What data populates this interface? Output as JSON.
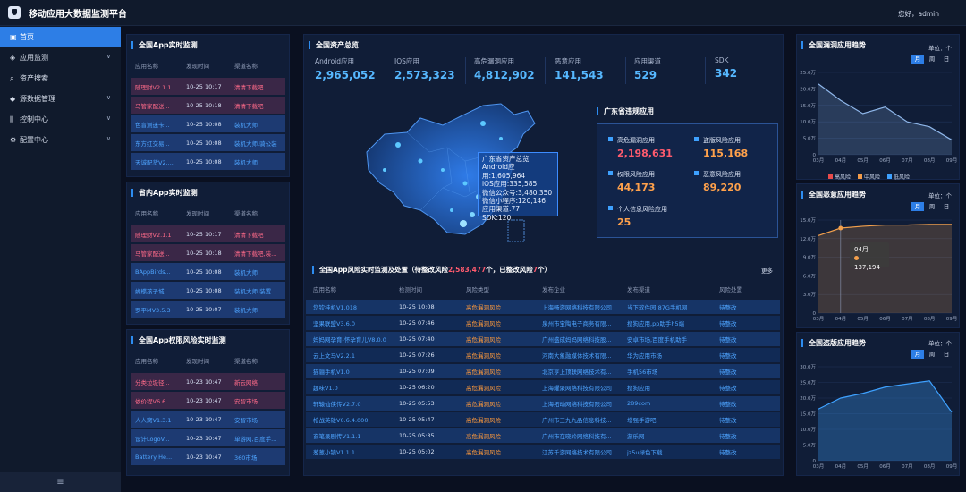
{
  "header": {
    "title": "移动应用大数据监测平台",
    "user": "您好，admin"
  },
  "sidebar": {
    "items": [
      {
        "label": "首页",
        "icon": "home-icon",
        "expandable": false
      },
      {
        "label": "应用监测",
        "icon": "cube-icon",
        "expandable": true
      },
      {
        "label": "资产搜索",
        "icon": "search-icon",
        "expandable": false
      },
      {
        "label": "源数据管理",
        "icon": "database-icon",
        "expandable": true
      },
      {
        "label": "控制中心",
        "icon": "sliders-icon",
        "expandable": true
      },
      {
        "label": "配置中心",
        "icon": "gear-icon",
        "expandable": true
      }
    ],
    "collapse_icon": "menu-collapse-icon"
  },
  "national_realtime": {
    "title": "全国App实时监测",
    "headers": [
      "应用名称",
      "发现时间",
      "渠道名称"
    ],
    "rows": [
      [
        "随理财V2.1.1",
        "10-25 10:17",
        "清清下载吧"
      ],
      [
        "马管家配送...",
        "10-25 10:18",
        "清清下载吧"
      ],
      [
        "色盲测迷卡...",
        "10-25 10:08",
        "装机大师"
      ],
      [
        "东方红交易...",
        "10-25 10:08",
        "装机大师,骑公装"
      ],
      [
        "天诚配货V2....",
        "10-25 10:08",
        "装机大师"
      ]
    ]
  },
  "provincial_realtime": {
    "title": "省内App实时监测",
    "headers": [
      "应用名称",
      "发现时间",
      "渠道名称"
    ],
    "rows": [
      [
        "随理财V2.1.1",
        "10-25 10:17",
        "清清下载吧"
      ],
      [
        "马管家配送...",
        "10-25 10:18",
        "清清下载吧,装..."
      ],
      [
        "BAppBirds...",
        "10-25 10:08",
        "装机大师"
      ],
      [
        "蝴蝶孩子城...",
        "10-25 10:08",
        "装机大师,装置..."
      ],
      [
        "罗平MV3.5.3",
        "10-25 10:07",
        "装机大师"
      ]
    ]
  },
  "permission_risk": {
    "title": "全国App权限风险实时监测",
    "headers": [
      "应用名称",
      "发现时间",
      "渠道名称"
    ],
    "rows": [
      [
        "分类垃圾径...",
        "10-23 10:47",
        "新云网络"
      ],
      [
        "依价程V6.6....",
        "10-23 10:47",
        "安智市场"
      ],
      [
        "人人窝V1.3.1",
        "10-23 10:47",
        "安智市场"
      ],
      [
        "设计LogoV...",
        "10-23 10:47",
        "单游网,百度手..."
      ],
      [
        "Battery He...",
        "10-23 10:47",
        "360市场"
      ]
    ]
  },
  "assets": {
    "title": "全国资产总览",
    "stats": [
      {
        "label": "Android应用",
        "value": "2,965,052"
      },
      {
        "label": "IOS应用",
        "value": "2,573,323"
      },
      {
        "label": "高危漏洞应用",
        "value": "4,812,902"
      },
      {
        "label": "恶意应用",
        "value": "141,543"
      },
      {
        "label": "应用渠道",
        "value": "529"
      },
      {
        "label": "SDK",
        "value": "342"
      }
    ]
  },
  "map_tooltip": {
    "title": "广东省资产总览",
    "lines": [
      "Android应用:1,605,964",
      "iOS应用:335,585",
      "微信公众号:3,480,350",
      "微信小程序:120,146",
      "应用渠道:77",
      "SDK:120"
    ]
  },
  "guangdong": {
    "title": "广东省违规应用",
    "items": [
      {
        "label": "高危漏洞应用",
        "value": "2,198,631"
      },
      {
        "label": "盗版风险应用",
        "value": "115,168"
      },
      {
        "label": "权限风险应用",
        "value": "44,173"
      },
      {
        "label": "恶意风险应用",
        "value": "89,220"
      },
      {
        "label": "个人信息风险应用",
        "value": "25"
      }
    ]
  },
  "risk_table": {
    "title_pre": "全国App风险实时监测及处置（待整改风险",
    "count_pending": "2,583,477",
    "title_mid": "个，已整改风险",
    "count_done": "7",
    "title_post": "个）",
    "more": "更多",
    "headers": [
      "应用名称",
      "检测时间",
      "风险类型",
      "发布企业",
      "发布渠道",
      "风险处置"
    ],
    "rows": [
      [
        "您钦挂机V1.018",
        "10-25 10:08",
        "高危漏洞风险",
        "上海畅游网络科技有限公司",
        "当下软件园,87G手机网",
        "待整改"
      ],
      [
        "坚果联盟V3.6.0",
        "10-25 07:46",
        "高危漏洞风险",
        "泉州市宝陶电子商务有限...",
        "搜狗应用,pp助手h5端",
        "待整改"
      ],
      [
        "妈妈网孕育-怀孕育儿V8.0.0",
        "10-25 07:40",
        "高危漏洞风险",
        "广州盛成妈妈网络科技股...",
        "安卓市场,百度手机助手",
        "待整改"
      ],
      [
        "云上文马V2.2.1",
        "10-25 07:26",
        "高危漏洞风险",
        "河南大象融媒体技术有限...",
        "华为应用市场",
        "待整改"
      ],
      [
        "猫骊手机V1.0",
        "10-25 07:09",
        "高危漏洞风险",
        "北京亨上顶联网络技术有...",
        "手机56市场",
        "待整改"
      ],
      [
        "趣味V1.0",
        "10-25 06:20",
        "高危漏洞风险",
        "上海耀聚网络科技有限公司",
        "搜狗应用",
        "待整改"
      ],
      [
        "轩辕仙侠传V2.7.0",
        "10-25 05:53",
        "高危漏洞风险",
        "上海拓动网络科技有限公司",
        "289com",
        "待整改"
      ],
      [
        "枪战英雄V0.6.4.000",
        "10-25 05:47",
        "高危漏洞风险",
        "广州市三九九品信息科技...",
        "增强手游吧",
        "待整改"
      ],
      [
        "玄笔录剧传V1.1.1",
        "10-25 05:35",
        "高危漏洞风险",
        "广州市在晓岭网络科技有...",
        "游乐网",
        "待整改"
      ],
      [
        "葱葱小镇V1.1.1",
        "10-25 05:02",
        "高危漏洞风险",
        "江苏千游网络技术有限公司",
        "jz5u绿色下载",
        "待整改"
      ]
    ]
  },
  "unit_label": "单位：个",
  "buttons": [
    "月",
    "周",
    "日"
  ],
  "vuln_trend": {
    "title": "全国漏洞应用趋势",
    "legend": [
      "高风险",
      "中风险",
      "低风险"
    ]
  },
  "malicious_trend": {
    "title": "全国恶意应用趋势",
    "tooltip_month": "04月",
    "tooltip_value": "137,194"
  },
  "pirated_trend": {
    "title": "全国盗版应用趋势"
  },
  "chart_data": [
    {
      "type": "line",
      "title": "全国漏洞应用趋势",
      "categories": [
        "03月",
        "04月",
        "05月",
        "06月",
        "07月",
        "08月",
        "09月"
      ],
      "series": [
        {
          "name": "中风险",
          "values": [
            21.5,
            16.5,
            12.5,
            14.5,
            10,
            8.5,
            4.5
          ],
          "color": "#8fb7ea"
        }
      ],
      "yticks": [
        "0",
        "5.0万",
        "10.0万",
        "15.0万",
        "20.0万",
        "25.0万"
      ],
      "ylim": [
        0,
        25
      ],
      "legend": [
        "高风险",
        "中风险",
        "低风险"
      ],
      "legend_colors": [
        "#e84b4b",
        "#f39c4a",
        "#3ea1ff"
      ]
    },
    {
      "type": "line",
      "title": "全国恶意应用趋势",
      "categories": [
        "03月",
        "04月",
        "05月",
        "06月",
        "07月",
        "08月",
        "09月"
      ],
      "series": [
        {
          "values": [
            12.5,
            13.7,
            14.0,
            14.2,
            14.2,
            14.3,
            14.3
          ],
          "color": "#f3a04c"
        }
      ],
      "yticks": [
        "0",
        "3.0万",
        "6.0万",
        "9.0万",
        "12.0万",
        "15.0万"
      ],
      "ylim": [
        0,
        15
      ],
      "highlight_index": 1
    },
    {
      "type": "area",
      "title": "全国盗版应用趋势",
      "categories": [
        "03月",
        "04月",
        "05月",
        "06月",
        "07月",
        "08月",
        "09月"
      ],
      "series": [
        {
          "values": [
            16.5,
            20.0,
            21.5,
            23.5,
            24.5,
            25.5,
            15.5
          ],
          "color": "#3ea1ff"
        }
      ],
      "yticks": [
        "0",
        "5.0万",
        "10.0万",
        "15.0万",
        "20.0万",
        "25.0万",
        "30.0万"
      ],
      "ylim": [
        0,
        30
      ]
    }
  ],
  "colors": {
    "accent": "#2d7ee6",
    "stat_value": "#56b8ff",
    "danger": "#ff5b6e",
    "orange": "#ffa14b"
  }
}
